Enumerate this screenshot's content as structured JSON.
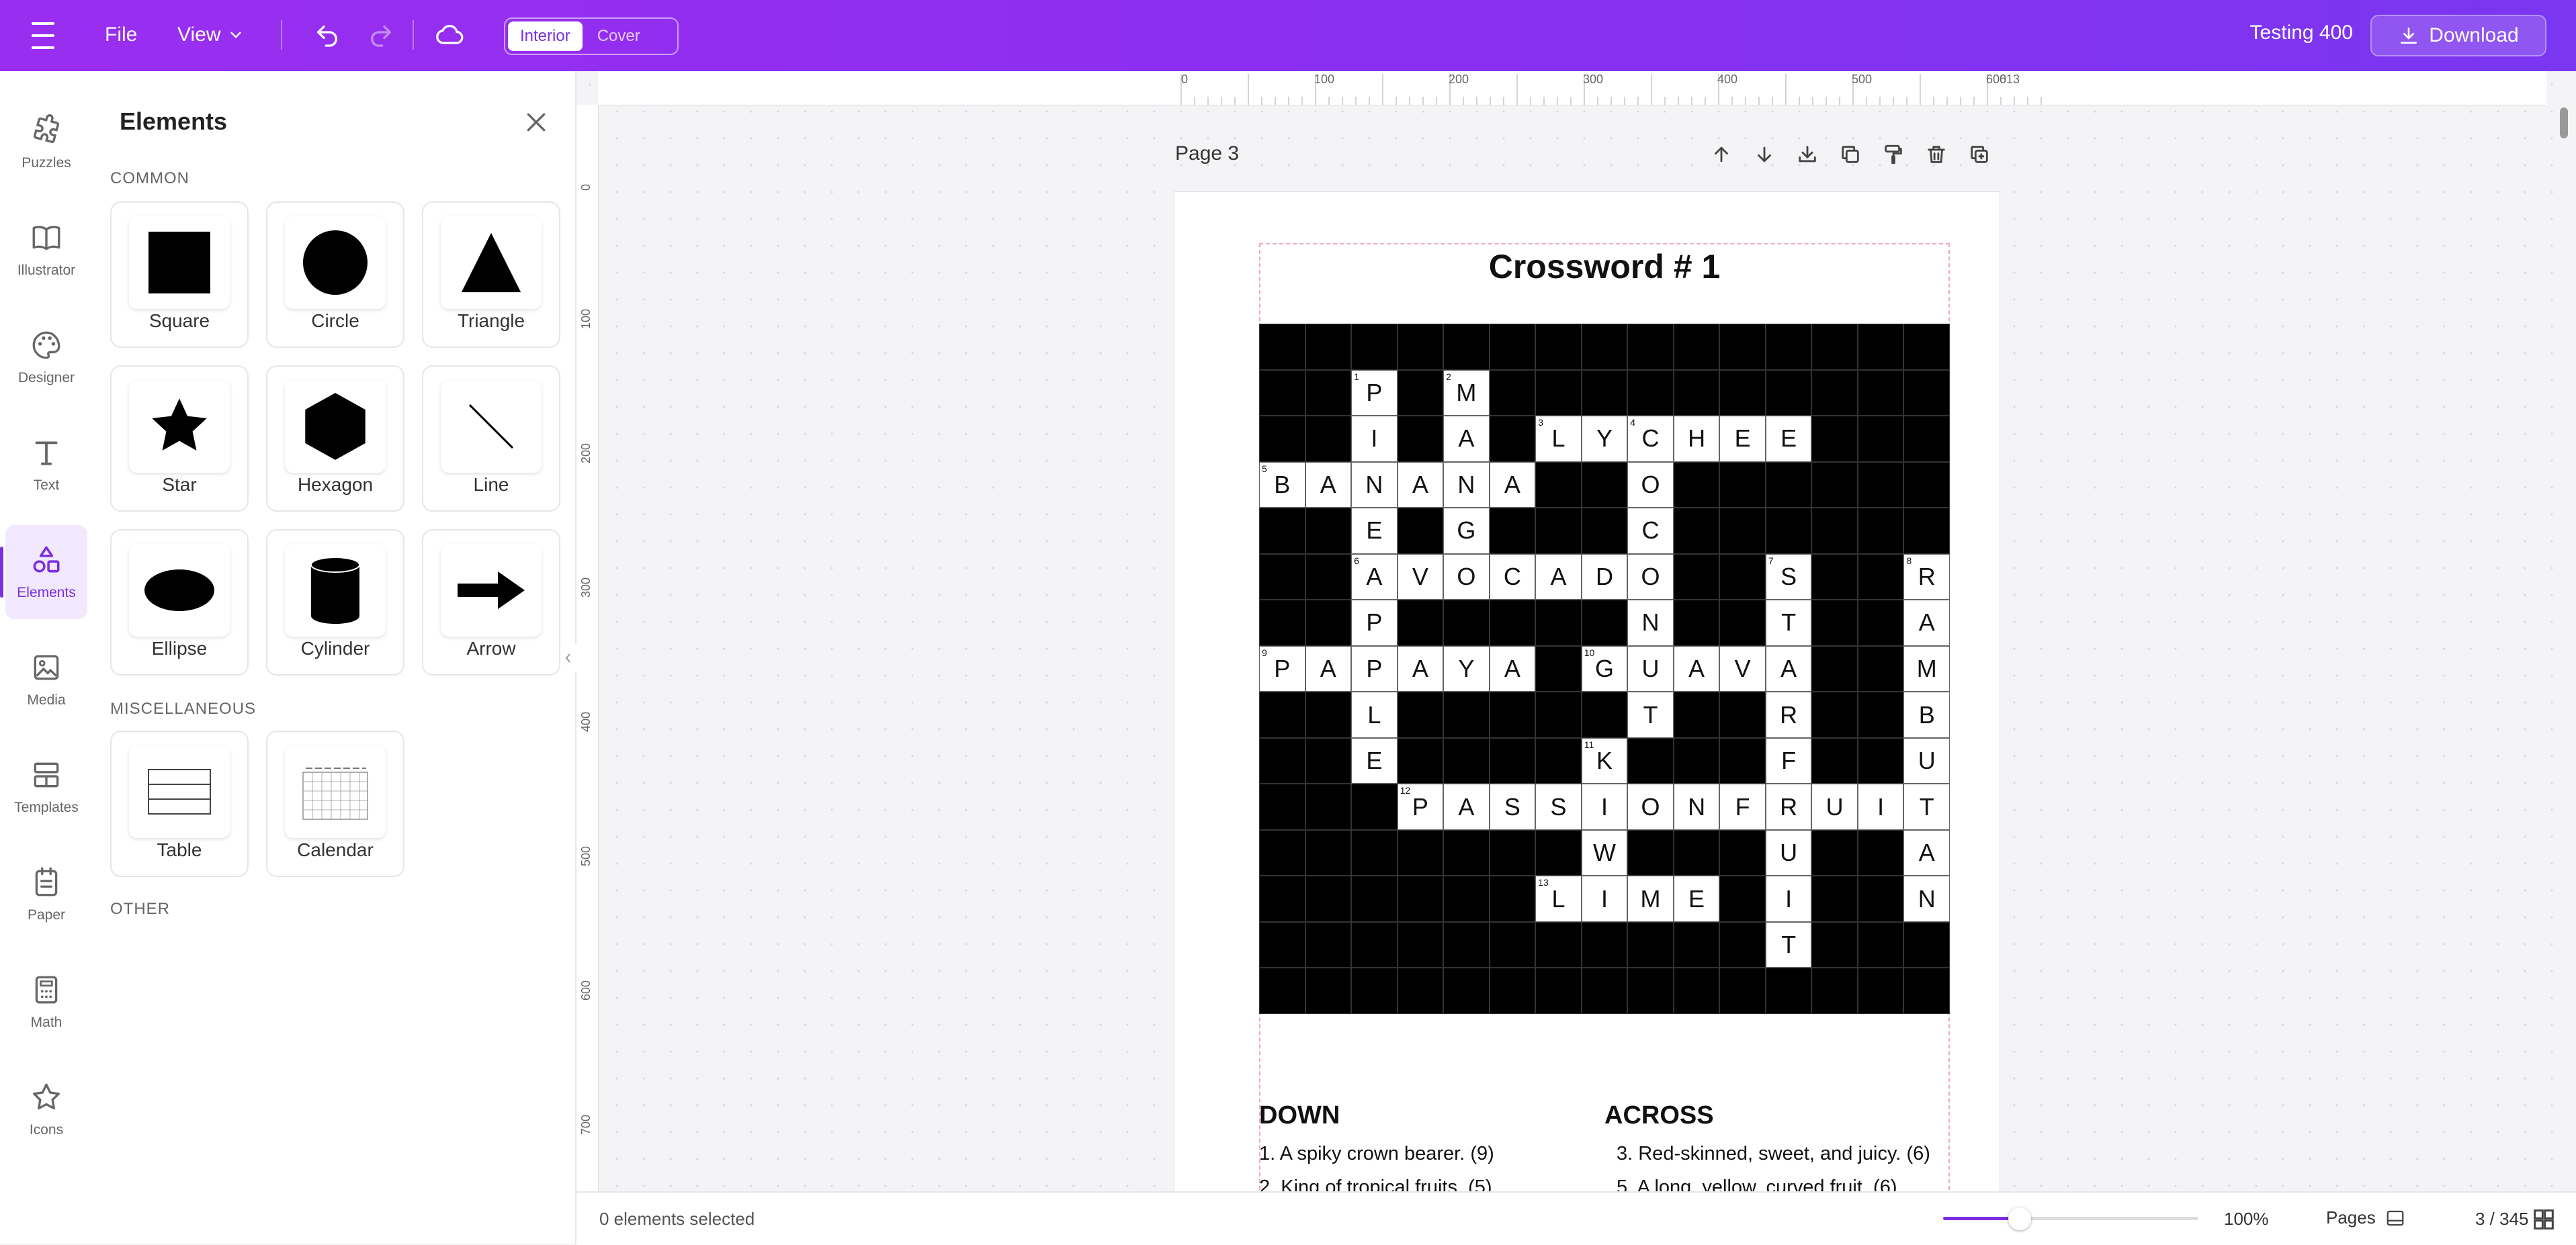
{
  "topbar": {
    "file_label": "File",
    "view_label": "View",
    "interior_label": "Interior",
    "cover_label": "Cover",
    "project_name": "Testing 400",
    "download_label": "Download"
  },
  "rail": {
    "items": [
      {
        "label": "Puzzles",
        "icon": "puzzle-icon"
      },
      {
        "label": "Illustrator",
        "icon": "book-icon"
      },
      {
        "label": "Designer",
        "icon": "palette-icon"
      },
      {
        "label": "Text",
        "icon": "text-icon"
      },
      {
        "label": "Elements",
        "icon": "shapes-icon",
        "active": true
      },
      {
        "label": "Media",
        "icon": "image-icon"
      },
      {
        "label": "Templates",
        "icon": "templates-icon"
      },
      {
        "label": "Paper",
        "icon": "paper-icon"
      },
      {
        "label": "Math",
        "icon": "calculator-icon"
      },
      {
        "label": "Icons",
        "icon": "star-outline-icon"
      }
    ]
  },
  "panel": {
    "title": "Elements",
    "common_label": "COMMON",
    "misc_label": "MISCELLANEOUS",
    "other_label": "OTHER",
    "common": [
      "Square",
      "Circle",
      "Triangle",
      "Star",
      "Hexagon",
      "Line",
      "Ellipse",
      "Cylinder",
      "Arrow"
    ],
    "misc": [
      "Table",
      "Calendar"
    ]
  },
  "ruler": {
    "h": [
      "0",
      "100",
      "200",
      "300",
      "400",
      "500",
      "600",
      "613"
    ],
    "v": [
      "0",
      "100",
      "200",
      "300",
      "400",
      "500",
      "600",
      "700"
    ]
  },
  "page": {
    "label": "Page 3",
    "title": "Crossword # 1"
  },
  "crossword": {
    "rows": [
      "...............",
      "..P.M..........",
      "..I.A.LYCHEE...",
      "BANANA..O......",
      "..E.G...C......",
      "..AVOCADO..S..R",
      "..P.....N..T..A",
      "PAPAYA.GUAVA..M",
      "..L.....T..R..B",
      "..E....K...F..U",
      "...PASSIONFRUIT",
      ".......W...U..A",
      "......LIME.I..N",
      "...........T...",
      "..............."
    ],
    "numbers": [
      {
        "r": 1,
        "c": 2,
        "n": "1"
      },
      {
        "r": 1,
        "c": 4,
        "n": "2"
      },
      {
        "r": 2,
        "c": 6,
        "n": "3"
      },
      {
        "r": 2,
        "c": 8,
        "n": "4"
      },
      {
        "r": 3,
        "c": 0,
        "n": "5"
      },
      {
        "r": 5,
        "c": 2,
        "n": "6"
      },
      {
        "r": 5,
        "c": 11,
        "n": "7"
      },
      {
        "r": 5,
        "c": 14,
        "n": "8"
      },
      {
        "r": 7,
        "c": 0,
        "n": "9"
      },
      {
        "r": 7,
        "c": 7,
        "n": "10"
      },
      {
        "r": 9,
        "c": 7,
        "n": "11"
      },
      {
        "r": 10,
        "c": 3,
        "n": "12"
      },
      {
        "r": 12,
        "c": 6,
        "n": "13"
      }
    ]
  },
  "clues": {
    "down_heading": "DOWN",
    "across_heading": "ACROSS",
    "down": [
      "1. A spiky crown bearer. (9)",
      "2. King of tropical fruits. (5)"
    ],
    "across": [
      "3. Red-skinned, sweet, and juicy. (6)",
      "5. A long, yellow, curved fruit. (6)"
    ]
  },
  "status": {
    "selection": "0 elements selected",
    "zoom": "100%",
    "zoom_level": 0.3,
    "pages_label": "Pages",
    "page_count": "3 / 345"
  },
  "colors": {
    "brand": "#8a2ff0",
    "accent": "#7a2fe0"
  }
}
